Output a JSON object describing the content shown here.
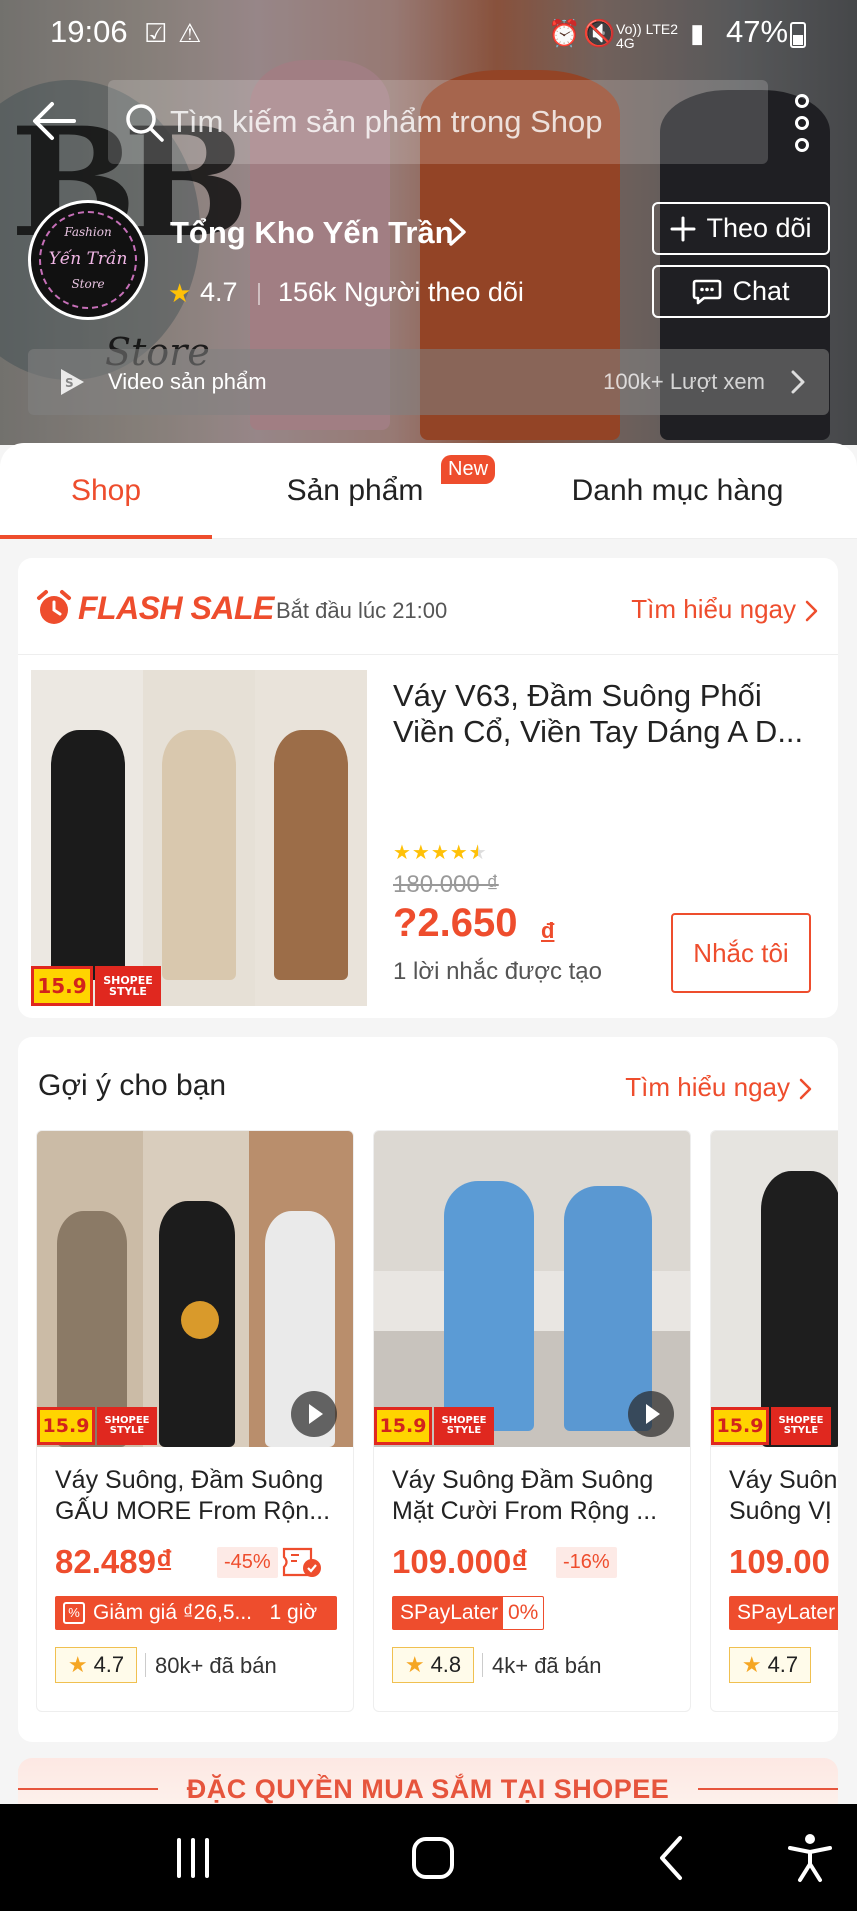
{
  "status_bar": {
    "time": "19:06",
    "network": "Vo)) LTE2 4G",
    "battery": "47%"
  },
  "search": {
    "placeholder": "Tìm kiếm sản phẩm trong Shop"
  },
  "shop": {
    "name": "Tổng Kho Yến Trần",
    "rating": "4.7",
    "followers": "156k Người theo dõi",
    "avatar_top": "Fashion",
    "avatar_name": "Yến Trần",
    "avatar_bottom": "Store",
    "banner_letters": "BB",
    "banner_script": "Store",
    "follow_label": "Theo dõi",
    "chat_label": "Chat"
  },
  "video": {
    "label": "Video sản phẩm",
    "views": "100k+ Lượt xem"
  },
  "tabs": {
    "shop": "Shop",
    "products": "Sản phẩm",
    "categories": "Danh mục hàng",
    "new_badge": "New"
  },
  "flash_sale": {
    "logo": "FLASH SALE",
    "start_time": "Bắt đầu lúc 21:00",
    "learn_more": "Tìm hiểu ngay",
    "product_title": "Váy V63, Đầm Suông Phối Viền Cổ, Viền Tay Dáng A D...",
    "rating_value": 4.5,
    "old_price": "180.000 ₫",
    "price": "?2.650",
    "currency": "đ",
    "reminder_count": "1 lời nhắc được tạo",
    "remind_button": "Nhắc tôi",
    "tag_159": "15.9",
    "tag_style": "SHOPEE STYLE"
  },
  "recommendations": {
    "title": "Gợi ý cho bạn",
    "learn_more": "Tìm hiểu ngay",
    "items": [
      {
        "name_line1": "Váy Suông, Đầm Suông",
        "name_line2": "GẤU MORE From Rộn...",
        "price": "82.489₫",
        "discount": "-45%",
        "promo": "Giảm giá ₫26,5...   1 giờ",
        "rating": "4.7",
        "sold": "80k+ đã bán"
      },
      {
        "name_line1": "Váy Suông Đầm Suông",
        "name_line2": "Mặt Cười From Rộng ...",
        "price": "109.000₫",
        "discount": "-16%",
        "promo": "SPayLater",
        "promo_rate": "0%",
        "rating": "4.8",
        "sold": "4k+ đã bán"
      },
      {
        "name_line1": "Váy Suôn",
        "name_line2": "Suông VỊ",
        "price": "109.00",
        "promo": "SPayLater",
        "rating": "4.7"
      }
    ]
  },
  "privilege_banner": "ĐẶC QUYỀN MUA SẮM TẠI SHOPEE",
  "icons": [
    "back-arrow-icon",
    "search-icon",
    "more-vertical-icon",
    "chevron-right-icon",
    "plus-icon",
    "chat-icon",
    "video-play-icon",
    "alarm-clock-icon",
    "play-icon",
    "coupon-icon",
    "recent-apps-icon",
    "home-icon",
    "back-icon",
    "accessibility-icon"
  ],
  "colors": {
    "accent": "#ee4d2d",
    "star": "#ffc107"
  }
}
